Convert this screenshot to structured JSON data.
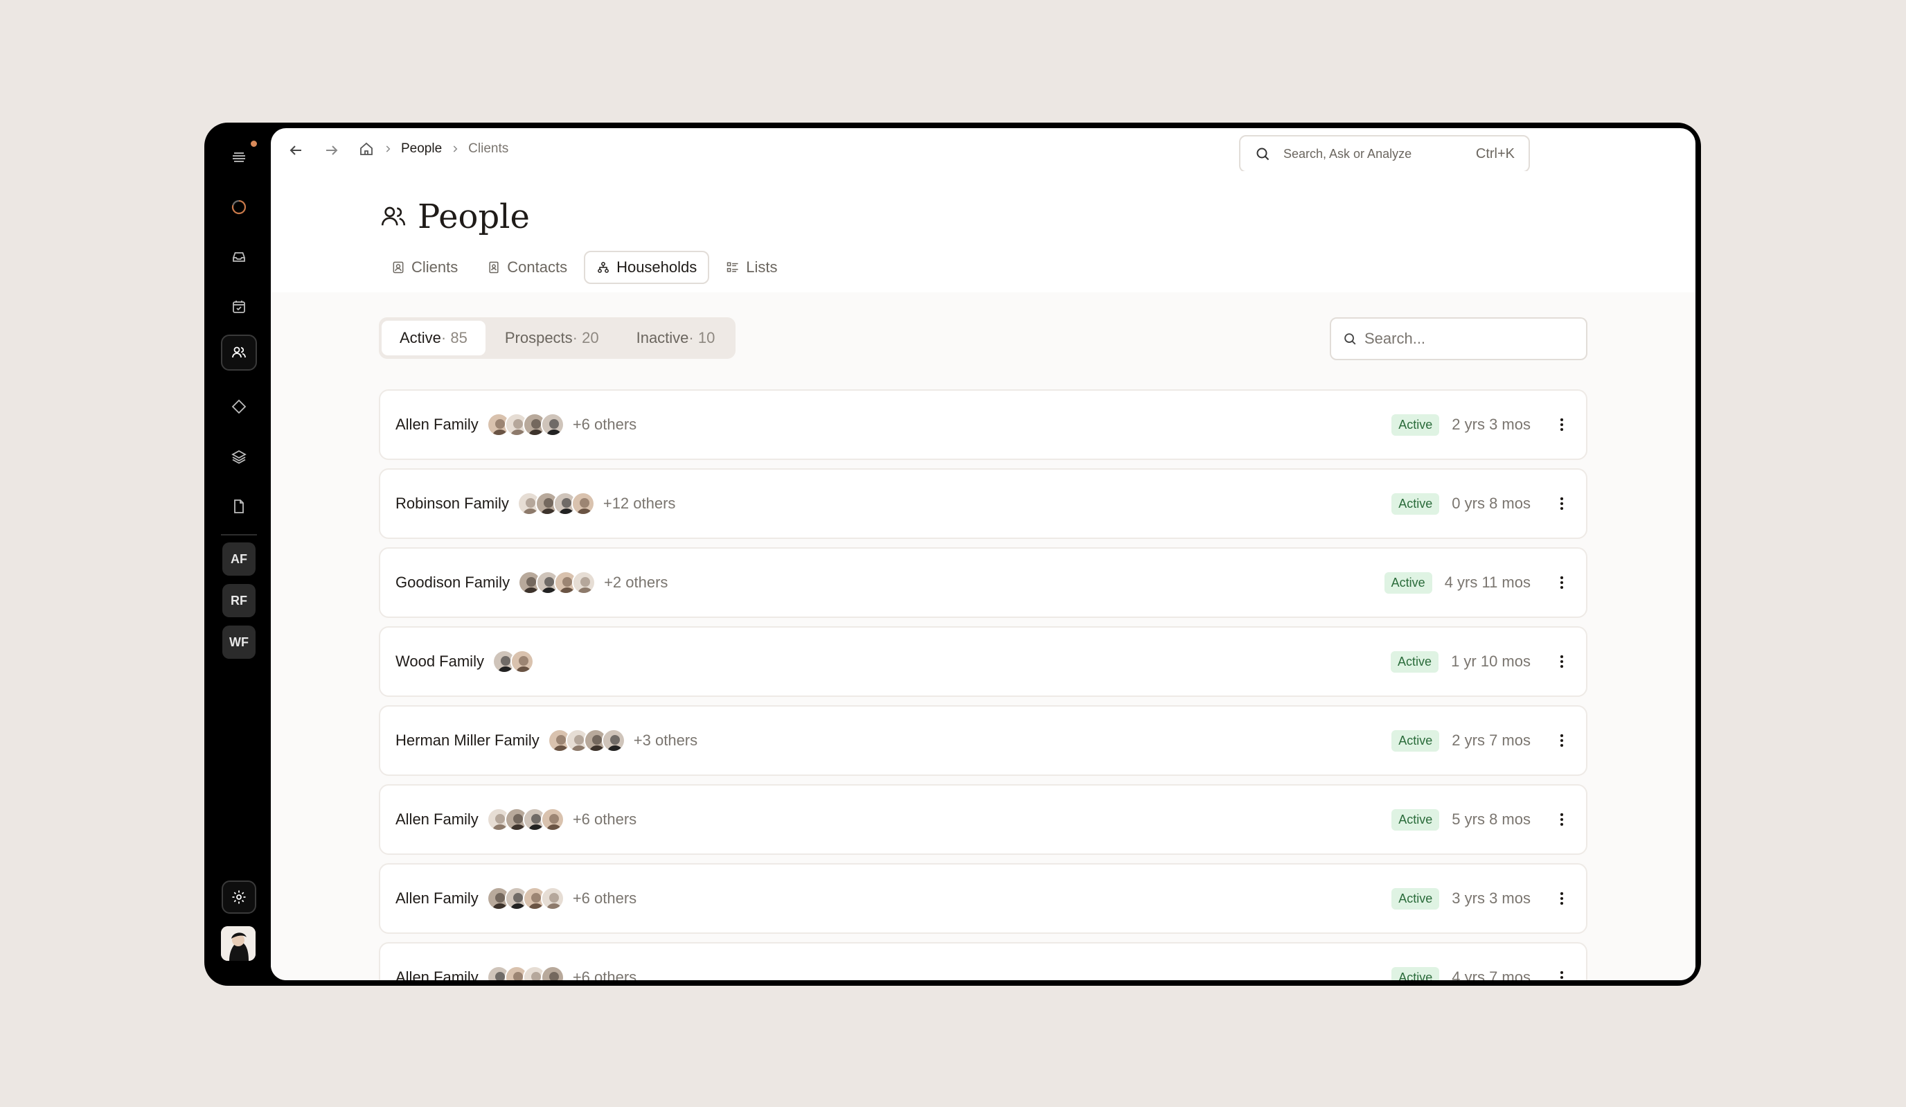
{
  "breadcrumb": {
    "item1": "People",
    "item2": "Clients"
  },
  "top_search": {
    "placeholder": "Search, Ask or Analyze",
    "shortcut": "Ctrl+K"
  },
  "page": {
    "title": "People"
  },
  "tabs": [
    {
      "label": "Clients",
      "icon": "contact-card-icon"
    },
    {
      "label": "Contacts",
      "icon": "contact-book-icon"
    },
    {
      "label": "Households",
      "icon": "household-tree-icon",
      "active": true
    },
    {
      "label": "Lists",
      "icon": "list-icon"
    }
  ],
  "filters": {
    "active": {
      "label": "Active",
      "count": " · 85"
    },
    "prospects": {
      "label": "Prospects",
      "count": " · 20"
    },
    "inactive": {
      "label": "Inactive",
      "count": " · 10"
    }
  },
  "list_search": {
    "placeholder": "Search..."
  },
  "sidebar": {
    "abbr": [
      "AF",
      "RF",
      "WF"
    ]
  },
  "households": [
    {
      "name": "Allen Family",
      "faces": 4,
      "others": "+6 others",
      "status": "Active",
      "duration": "2 yrs 3 mos"
    },
    {
      "name": "Robinson Family",
      "faces": 4,
      "others": "+12 others",
      "status": "Active",
      "duration": "0 yrs 8 mos"
    },
    {
      "name": "Goodison Family",
      "faces": 4,
      "others": "+2 others",
      "status": "Active",
      "duration": "4 yrs 11 mos"
    },
    {
      "name": "Wood Family",
      "faces": 2,
      "others": "",
      "status": "Active",
      "duration": "1 yr 10 mos"
    },
    {
      "name": "Herman Miller Family",
      "faces": 4,
      "others": "+3 others",
      "status": "Active",
      "duration": "2 yrs 7 mos"
    },
    {
      "name": "Allen Family",
      "faces": 4,
      "others": "+6 others",
      "status": "Active",
      "duration": "5 yrs 8 mos"
    },
    {
      "name": "Allen Family",
      "faces": 4,
      "others": "+6 others",
      "status": "Active",
      "duration": "3 yrs 3 mos"
    },
    {
      "name": "Allen Family",
      "faces": 4,
      "others": "+6 others",
      "status": "Active",
      "duration": "4 yrs 7 mos"
    }
  ],
  "colors": {
    "accent_dot": "#d98a5a",
    "badge_bg": "#dff3e3",
    "badge_text": "#2a6b3a",
    "sidebar_bg": "#000000",
    "page_bg": "#ece7e3"
  }
}
